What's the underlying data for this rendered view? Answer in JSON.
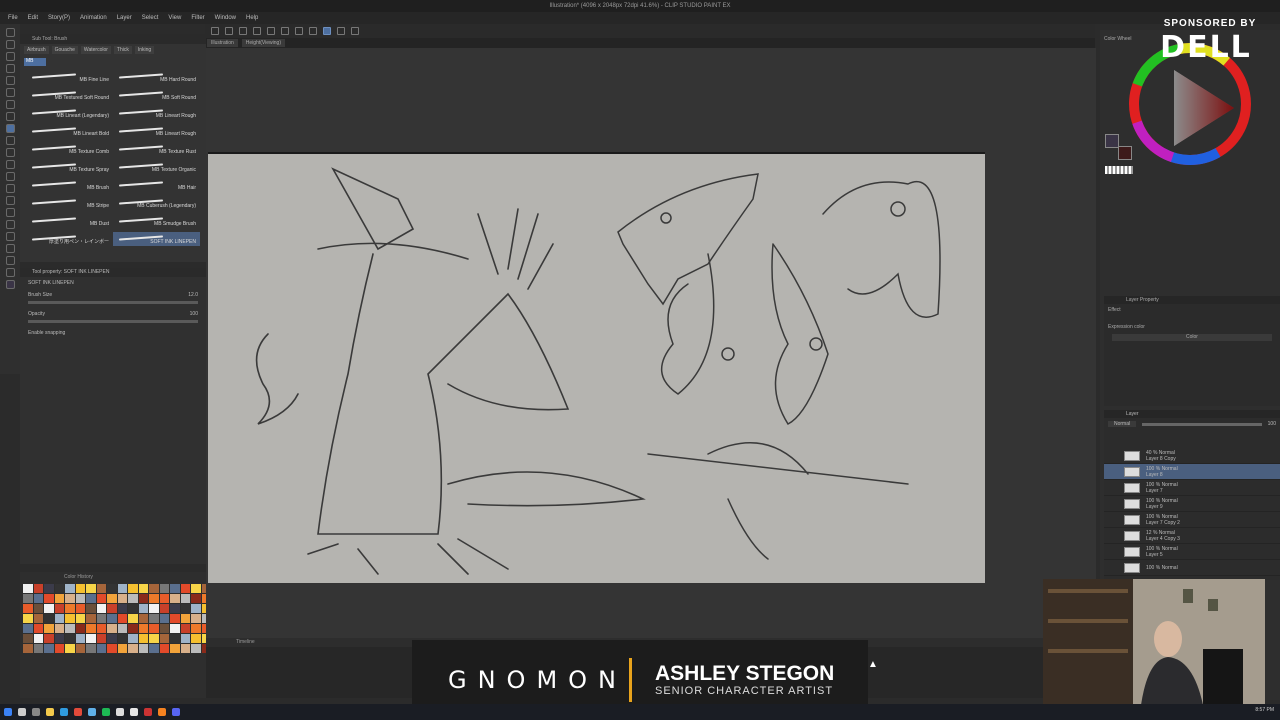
{
  "app": {
    "title": "Illustration* (4096 x 2048px 72dpi 41.6%) - CLIP STUDIO PAINT EX"
  },
  "menu": [
    "File",
    "Edit",
    "Story(P)",
    "Animation",
    "Layer",
    "Select",
    "View",
    "Filter",
    "Window",
    "Help"
  ],
  "doc_tabs": [
    "Illustration",
    "Height(Viewing)"
  ],
  "brush_panel": {
    "header": "Sub Tool: Brush",
    "tabs": [
      "Airbrush",
      "Gouache",
      "Watercolor",
      "Thick",
      "Inking"
    ],
    "group": "MB",
    "brushes": [
      "MB Fine Line",
      "MB Hard Round",
      "MB Textured Soft Round",
      "MB Soft Round",
      "MB Lineart (Legendary)",
      "MB Lineart Rough",
      "MB Lineart Bold",
      "MB Lineart Rough",
      "MB Texture Comb",
      "MB Texture Rust",
      "MB Texture Spray",
      "MB Texture Organic",
      "MB Brush",
      "MB Hair",
      "MB Stripe",
      "MB Cuberush (Legendary)",
      "MB Dust",
      "MB Smudge Brush",
      "厚塗り用ペン・レインボー",
      "SOFT INK LINEPEN"
    ],
    "selected_brush": "SOFT INK LINEPEN"
  },
  "tool_property": {
    "header": "Tool property: SOFT INK LINEPEN",
    "brush_name": "SOFT INK LINEPEN",
    "brush_size_label": "Brush Size",
    "brush_size_value": "12.0",
    "opacity_label": "Opacity",
    "opacity_value": "100",
    "snapping_label": "Enable snapping"
  },
  "color_history_label": "Color History",
  "timeline_label": "Timeline",
  "color_wheel_label": "Color Wheel",
  "layer_property": {
    "header": "Layer Property",
    "effect_label": "Effect",
    "expression_label": "Expression color",
    "expression_value": "Color"
  },
  "layer_panel": {
    "header": "Layer",
    "blend_mode": "Normal",
    "opacity": "100",
    "layers": [
      {
        "opacity": "40 % Normal",
        "name": "Layer 8 Copy"
      },
      {
        "opacity": "100 % Normal",
        "name": "Layer 8",
        "selected": true
      },
      {
        "opacity": "100 % Normal",
        "name": "Layer 7"
      },
      {
        "opacity": "100 % Normal",
        "name": "Layer 9"
      },
      {
        "opacity": "100 % Normal",
        "name": "Layer 7 Copy 2"
      },
      {
        "opacity": "12 % Normal",
        "name": "Layer 4 Copy 3"
      },
      {
        "opacity": "100 % Normal",
        "name": "Layer 5"
      },
      {
        "opacity": "100 % Normal",
        "name": ""
      }
    ]
  },
  "sponsor": {
    "label": "SPONSORED BY",
    "brand": "DELL"
  },
  "lower_third": {
    "brand": "GNOMON",
    "name": "ASHLEY STEGON",
    "title": "SENIOR CHARACTER ARTIST"
  },
  "taskbar_time": "8:57 PM",
  "colors": {
    "accent": "#e8a31c",
    "selection": "#4a5f7f",
    "canvas_bg": "#b5b4b0"
  }
}
